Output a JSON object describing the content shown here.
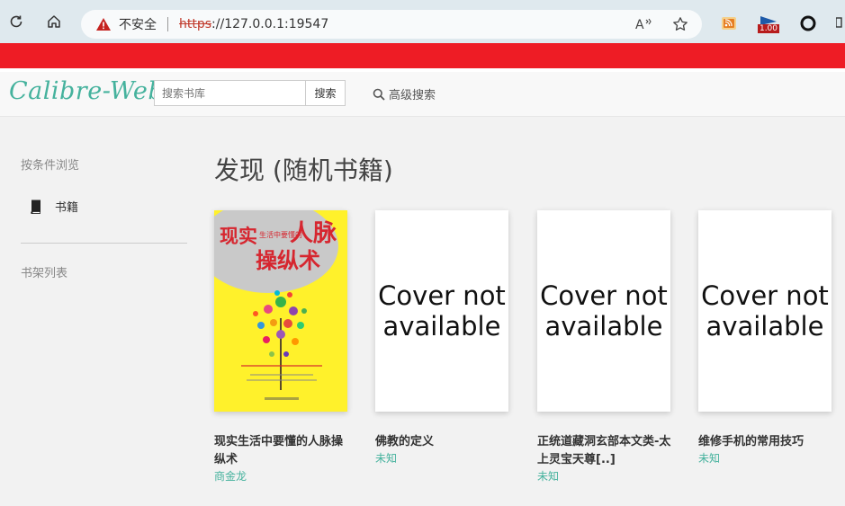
{
  "browser": {
    "insecure_label": "不安全",
    "url_scheme": "https",
    "url_rest": "://127.0.0.1:19547",
    "extension_badge": "1.00"
  },
  "header": {
    "logo": "Calibre-Web",
    "search_placeholder": "搜索书库",
    "search_button": "搜索",
    "advanced_search": "高级搜索"
  },
  "sidebar": {
    "browse_heading": "按条件浏览",
    "items": [
      {
        "label": "书籍",
        "icon": "book-icon"
      }
    ],
    "shelves_heading": "书架列表"
  },
  "main": {
    "title": "发现 (随机书籍)",
    "cover_placeholder": "Cover not available",
    "books": [
      {
        "title": "现实生活中要懂的人脉操纵术",
        "author": "商金龙",
        "cover_title_a": "现实",
        "cover_title_b": "人脉",
        "cover_title_c": "生活中要懂的",
        "cover_title_d": "操纵术"
      },
      {
        "title": "佛教的定义",
        "author": "未知"
      },
      {
        "title": "正统道藏洞玄部本文类-太上灵宝天尊[..]",
        "author": "未知"
      },
      {
        "title": "维修手机的常用技巧",
        "author": "未知"
      }
    ]
  },
  "colors": {
    "accent": "#45b29d",
    "red_bar": "#ee1c25",
    "cover_yellow": "#fff12b"
  }
}
